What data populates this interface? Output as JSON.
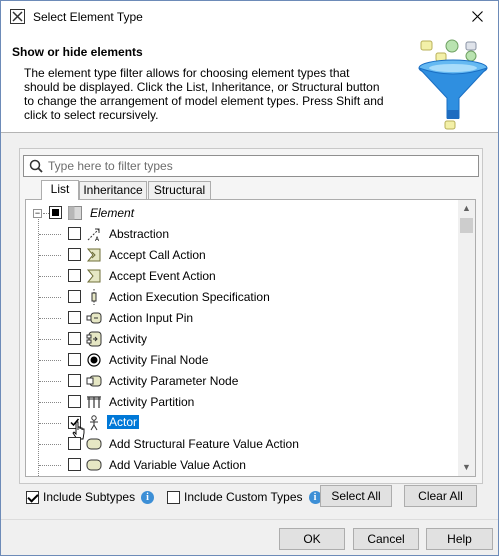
{
  "window": {
    "title": "Select Element Type"
  },
  "header": {
    "title": "Show or hide elements",
    "description": "The element type filter allows for choosing element types that should be displayed. Click the List, Inheritance, or Structural button to change the arrangement of model element types. Press Shift and click to select recursively."
  },
  "search": {
    "placeholder": "Type here to filter types",
    "value": ""
  },
  "tabs": [
    {
      "label": "List",
      "active": true
    },
    {
      "label": "Inheritance",
      "active": false
    },
    {
      "label": "Structural",
      "active": false
    }
  ],
  "tree": {
    "root": {
      "label": "Element",
      "checked": "partial"
    },
    "items": [
      {
        "label": "Abstraction",
        "checked": false,
        "icon": "abstraction-icon"
      },
      {
        "label": "Accept Call Action",
        "checked": false,
        "icon": "accept-call-action-icon"
      },
      {
        "label": "Accept Event Action",
        "checked": false,
        "icon": "accept-event-action-icon"
      },
      {
        "label": "Action Execution Specification",
        "checked": false,
        "icon": "action-execution-spec-icon"
      },
      {
        "label": "Action Input Pin",
        "checked": false,
        "icon": "action-input-pin-icon"
      },
      {
        "label": "Activity",
        "checked": false,
        "icon": "activity-icon"
      },
      {
        "label": "Activity Final Node",
        "checked": false,
        "icon": "activity-final-node-icon"
      },
      {
        "label": "Activity Parameter Node",
        "checked": false,
        "icon": "activity-parameter-node-icon"
      },
      {
        "label": "Activity Partition",
        "checked": false,
        "icon": "activity-partition-icon"
      },
      {
        "label": "Actor",
        "checked": true,
        "icon": "actor-icon",
        "selected": true
      },
      {
        "label": "Add Structural Feature Value Action",
        "checked": false,
        "icon": "action-icon"
      },
      {
        "label": "Add Variable Value Action",
        "checked": false,
        "icon": "action-icon"
      }
    ]
  },
  "options": {
    "include_subtypes": {
      "label": "Include Subtypes",
      "checked": true
    },
    "include_custom_types": {
      "label": "Include Custom Types",
      "checked": false
    }
  },
  "buttons": {
    "select_all": "Select All",
    "clear_all": "Clear All",
    "ok": "OK",
    "cancel": "Cancel",
    "help": "Help"
  },
  "colors": {
    "selection": "#0078d7",
    "info": "#3d8fd6",
    "funnel": "#2f8fe0"
  }
}
